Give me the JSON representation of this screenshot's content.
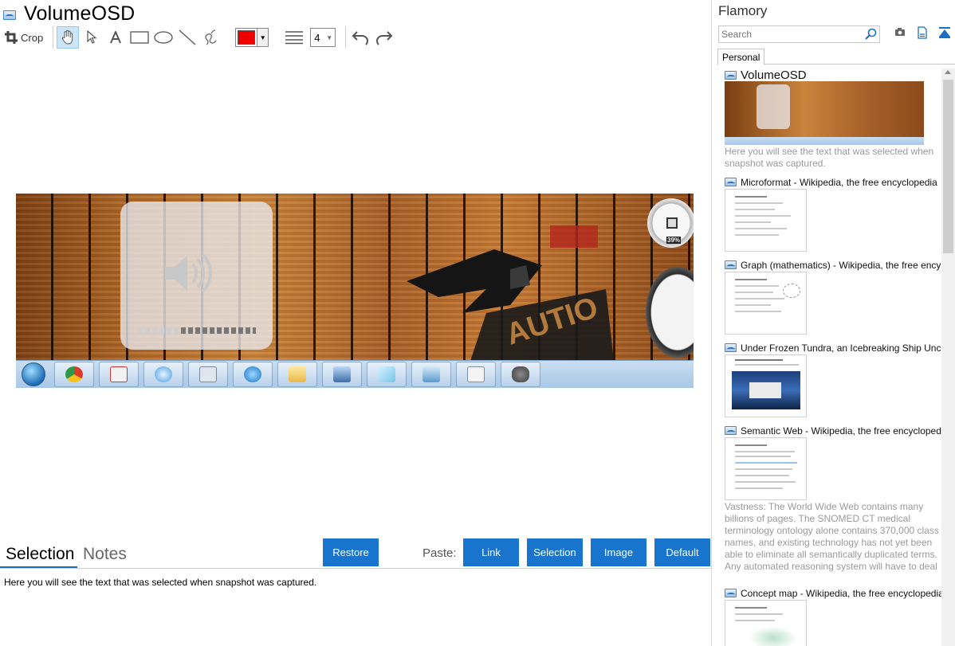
{
  "document": {
    "title": "VolumeOSD",
    "toolbar": {
      "crop_label": "Crop",
      "line_width": "4",
      "color": "#ee0000"
    },
    "tabs": [
      {
        "label": "Selection",
        "active": true
      },
      {
        "label": "Notes",
        "active": false
      }
    ],
    "buttons": {
      "restore": "Restore",
      "paste_label": "Paste:",
      "link": "Link",
      "selection": "Selection",
      "image": "Image",
      "default": "Default"
    },
    "selection_text": "Here you will see the text that was selected when snapshot was captured.",
    "snapshot": {
      "gauge_percent": "39%"
    }
  },
  "sidebar": {
    "app_title": "Flamory",
    "search_placeholder": "Search",
    "tab": "Personal",
    "items": [
      {
        "title": "VolumeOSD",
        "snippet": "Here you will see the text that was selected when snapshot was captured."
      },
      {
        "title": "Microformat - Wikipedia, the free encyclopedia",
        "snippet": ""
      },
      {
        "title": "Graph (mathematics) - Wikipedia, the free ency",
        "snippet": ""
      },
      {
        "title": "Under Frozen Tundra, an Icebreaking Ship Unco",
        "snippet": ""
      },
      {
        "title": "Semantic Web - Wikipedia, the free encycloped",
        "snippet": "Vastness: The World Wide Web contains many billions of pages. The SNOMED CT medical terminology ontology alone contains 370,000 class names, and existing technology has not yet been able to eliminate all semantically duplicated terms. Any automated reasoning system will have to deal with truly huge inputs."
      },
      {
        "title": "Concept map - Wikipedia, the free encyclopedia",
        "snippet": ""
      }
    ]
  },
  "colors": {
    "accent": "#1874cd",
    "tab_underline": "#1a6fc4"
  }
}
